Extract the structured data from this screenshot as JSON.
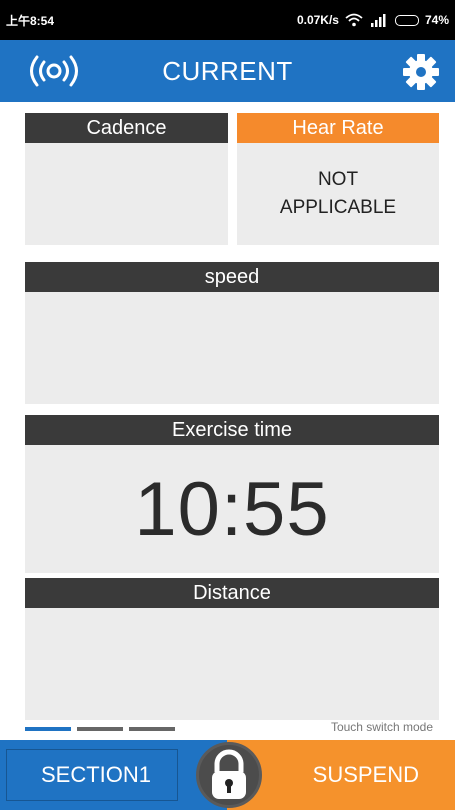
{
  "status_bar": {
    "time": "上午8:54",
    "network_speed": "0.07K/s",
    "battery": "74%",
    "icons": [
      "wifi-icon",
      "cell-signal-icon",
      "battery-icon"
    ]
  },
  "app_bar": {
    "title": "CURRENT",
    "left_icon": "broadcast-signal-icon",
    "right_icon": "gear-icon",
    "color": "#1f73c3"
  },
  "panels": {
    "cadence": {
      "title": "Cadence",
      "value": ""
    },
    "heart_rate": {
      "title": "Hear Rate",
      "value": "NOT\nAPPLICABLE",
      "accent": "#f58a2c"
    },
    "speed": {
      "title": "speed",
      "value": ""
    },
    "exercise_time": {
      "title": "Exercise time",
      "value": "10:55"
    },
    "distance": {
      "title": "Distance",
      "value": ""
    }
  },
  "pager": {
    "pages": 3,
    "active": 0
  },
  "hint": "Touch switch mode",
  "bottom": {
    "section_label": "SECTION1",
    "suspend_label": "SUSPEND",
    "lock_icon": "padlock-icon",
    "section_color": "#1f73c3",
    "suspend_color": "#f5922c"
  }
}
